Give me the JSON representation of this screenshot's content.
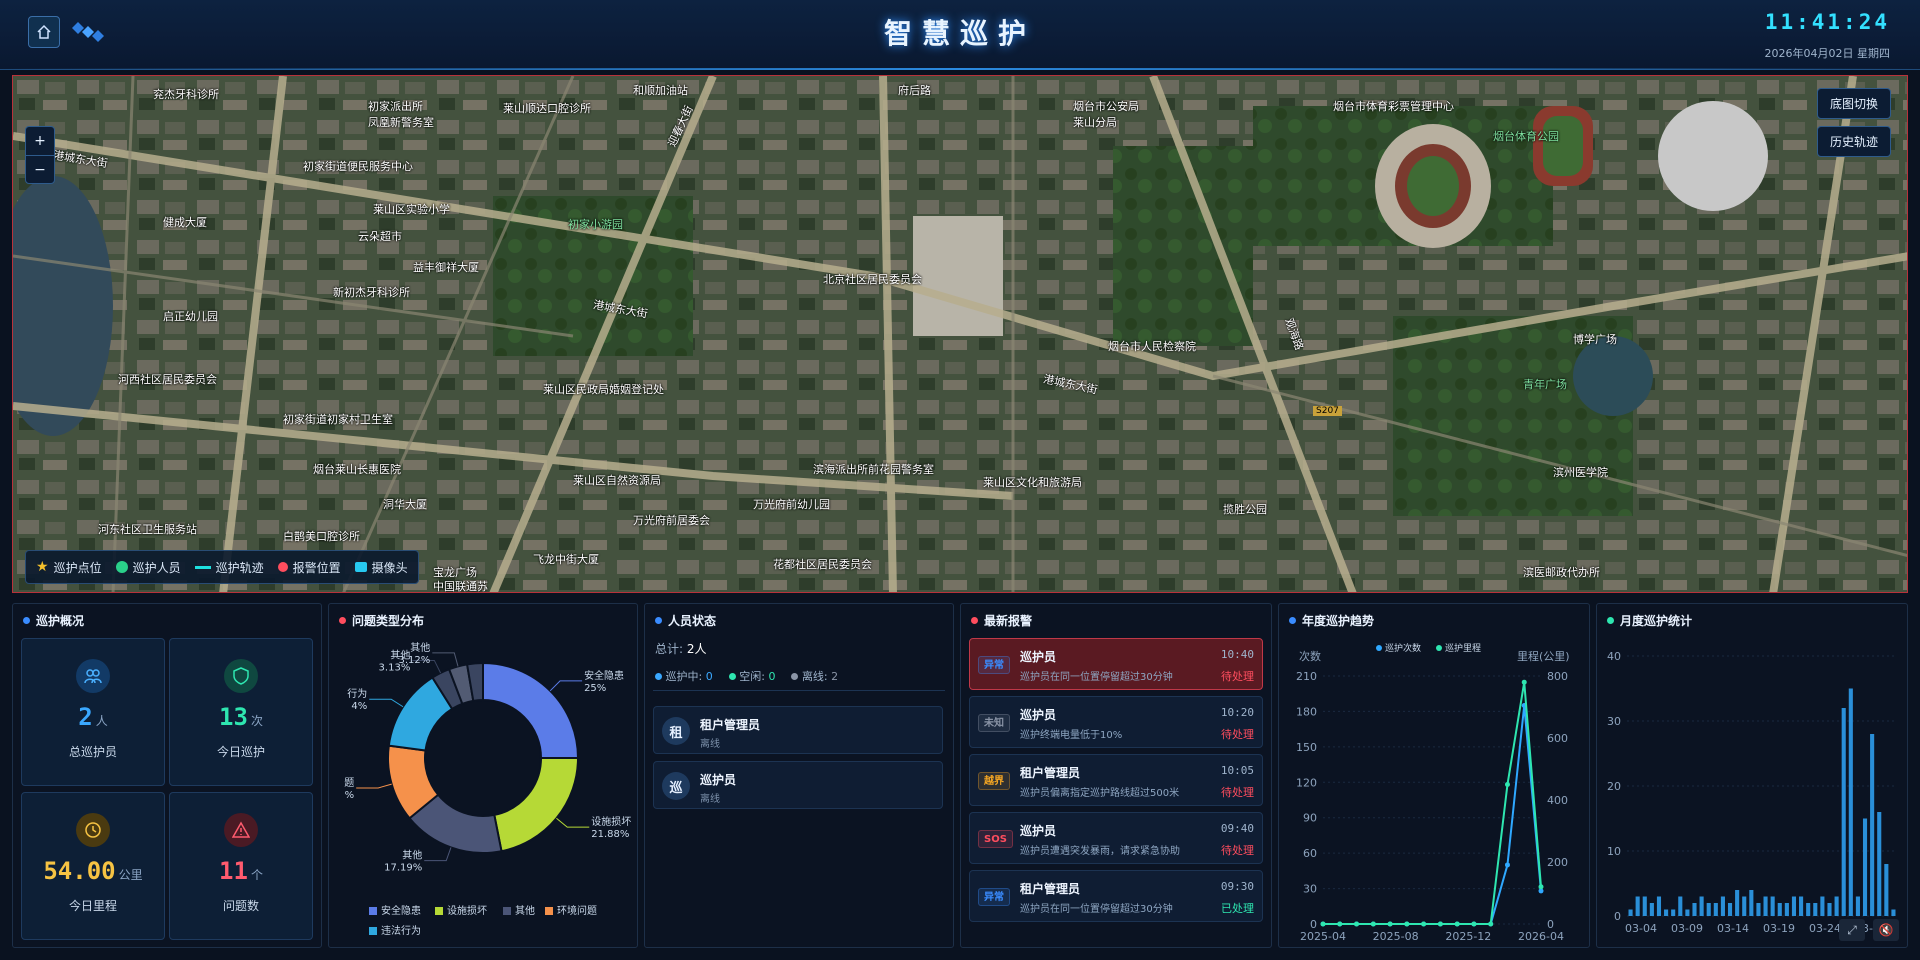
{
  "header": {
    "title": "智慧巡护",
    "time": "11:41:24",
    "date": "2026年04月02日 星期四"
  },
  "map": {
    "buttons": {
      "basemap": "底图切换",
      "history": "历史轨迹"
    },
    "zoom_in": "+",
    "zoom_out": "−",
    "legend": [
      {
        "label": "巡护点位",
        "color": "#f5c02c"
      },
      {
        "label": "巡护人员",
        "color": "#2ad08a"
      },
      {
        "label": "巡护轨迹",
        "color": "#1ee0e0"
      },
      {
        "label": "报警位置",
        "color": "#ff4d5e"
      },
      {
        "label": "摄像头",
        "color": "#27c9f0"
      }
    ],
    "labels": [
      "兖杰牙科诊所",
      "初家派出所",
      "凤凰新警务室",
      "莱山顺达口腔诊所",
      "和顺加油站",
      "府后路",
      "烟台市公安局",
      "莱山分局",
      "烟台市体育彩票管理中心",
      "烟台体育公园",
      "初家街道便民服务中心",
      "莱山区实验小学",
      "健成大厦",
      "云朵超市",
      "初家小游园",
      "益丰御祥大厦",
      "新初杰牙科诊所",
      "启正幼儿园",
      "北京社区居民委员会",
      "烟台市人民检察院",
      "河西社区居民委员会",
      "莱山区民政局婚姻登记处",
      "初家街道初家村卫生室",
      "烟台莱山长惠医院",
      "莱山区自然资源局",
      "滨海派出所前花园警务室",
      "万光府前幼儿园",
      "莱山区文化和旅游局",
      "洞华大厦",
      "万光府前居委会",
      "揽胜公园",
      "河东社区卫生服务站",
      "白鹊美口腔诊所",
      "飞龙中街大厦",
      "花都社区居民委员会",
      "宝龙广场",
      "中国联通苏",
      "滨医邮政代办所",
      "青年广场",
      "博学广场",
      "滨州医学院",
      "港城东大街",
      "港城东大街",
      "港城东大街",
      "观海路",
      "迎春大街",
      "S207"
    ]
  },
  "overview": {
    "title": "巡护概况",
    "cards": [
      {
        "value": "2",
        "unit": "人",
        "label": "总巡护员",
        "color": "#3aa8ff"
      },
      {
        "value": "13",
        "unit": "次",
        "label": "今日巡护",
        "color": "#2ee6b0"
      },
      {
        "value": "54.00",
        "unit": "公里",
        "label": "今日里程",
        "color": "#f6c343"
      },
      {
        "value": "11",
        "unit": "个",
        "label": "问题数",
        "color": "#ff5b6e"
      }
    ]
  },
  "issues": {
    "title": "问题类型分布",
    "chart_data": {
      "type": "pie",
      "slices": [
        {
          "name": "安全隐患",
          "value": 25,
          "color": "#5b7ce8",
          "label": "安全隐患",
          "pct": "25%"
        },
        {
          "name": "设施损坏",
          "value": 21.88,
          "color": "#b6d936",
          "label": "设施损坏",
          "pct": "21.88%"
        },
        {
          "name": "其他",
          "value": 17.19,
          "color": "#4b5577",
          "label": "其他",
          "pct": "17.19%"
        },
        {
          "name": "环境问题",
          "value": 13,
          "color": "#f5914b",
          "label": "题",
          "pct": "%"
        },
        {
          "name": "违法行为",
          "value": 14,
          "color": "#2fa8e0",
          "label": "行为",
          "pct": "4%"
        },
        {
          "name": "其他",
          "value": 3.13,
          "color": "#3a4560",
          "label": "其他",
          "pct": "3.13%"
        },
        {
          "name": "其他",
          "value": 3.12,
          "color": "#525b73",
          "label": "其他",
          "pct": "3.12%"
        },
        {
          "name": "其他",
          "value": 2.68,
          "color": "#3a4560",
          "label": "",
          "pct": ""
        }
      ],
      "legend": [
        "安全隐患",
        "设施损坏",
        "其他",
        "环境问题",
        "违法行为"
      ]
    }
  },
  "people": {
    "title": "人员状态",
    "total_label": "总计:",
    "total_value": "2人",
    "statuses": [
      {
        "label": "巡护中:",
        "value": "0",
        "color": "#3aa8ff"
      },
      {
        "label": "空闲:",
        "value": "0",
        "color": "#2ee6b0"
      },
      {
        "label": "离线:",
        "value": "2",
        "color": "#8a94a6"
      }
    ],
    "list": [
      {
        "avatar": "租",
        "name": "租户管理员",
        "status": "离线"
      },
      {
        "avatar": "巡",
        "name": "巡护员",
        "status": "离线"
      }
    ]
  },
  "alerts": {
    "title": "最新报警",
    "items": [
      {
        "tag": "异常",
        "tag_color": "#3a8cff",
        "name": "巡护员",
        "desc": "巡护员在同一位置停留超过30分钟",
        "time": "10:40",
        "status": "待处理",
        "status_color": "#ff4d5e",
        "hot": true
      },
      {
        "tag": "未知",
        "tag_color": "#8a94a6",
        "name": "巡护员",
        "desc": "巡护终端电量低于10%",
        "time": "10:20",
        "status": "待处理",
        "status_color": "#ff4d5e",
        "hot": false
      },
      {
        "tag": "越界",
        "tag_color": "#f5a623",
        "name": "租户管理员",
        "desc": "巡护员偏离指定巡护路线超过500米",
        "time": "10:05",
        "status": "待处理",
        "status_color": "#ff4d5e",
        "hot": false
      },
      {
        "tag": "SOS",
        "tag_color": "#ff4d5e",
        "name": "巡护员",
        "desc": "巡护员遭遇突发暴雨，请求紧急协助",
        "time": "09:40",
        "status": "待处理",
        "status_color": "#ff4d5e",
        "hot": false
      },
      {
        "tag": "异常",
        "tag_color": "#3a8cff",
        "name": "租户管理员",
        "desc": "巡护员在同一位置停留超过30分钟",
        "time": "09:30",
        "status": "已处理",
        "status_color": "#2ee6b0",
        "hot": false
      }
    ]
  },
  "trend": {
    "title": "年度巡护趋势",
    "chart_data": {
      "type": "line",
      "left_axis_label": "次数",
      "right_axis_label": "里程(公里)",
      "legend": [
        "巡护次数",
        "巡护里程"
      ],
      "x_ticks": [
        "2025-04",
        "2025-08",
        "2025-12",
        "2026-04"
      ],
      "y_left_ticks": [
        0,
        30,
        60,
        90,
        120,
        150,
        180,
        210
      ],
      "y_right_ticks": [
        0,
        200,
        400,
        600,
        800
      ],
      "ylim_left": [
        0,
        210
      ],
      "ylim_right": [
        0,
        800
      ],
      "x": [
        0,
        1,
        2,
        3,
        4,
        5,
        6,
        7,
        8,
        9,
        10,
        11,
        12
      ],
      "series": [
        {
          "name": "巡护次数",
          "color": "#2fa8ff",
          "axis": "left",
          "values": [
            0,
            0,
            0,
            0,
            0,
            0,
            0,
            0,
            0,
            0,
            0,
            50,
            185,
            28
          ]
        },
        {
          "name": "巡护里程",
          "color": "#2ee6b0",
          "axis": "right",
          "values": [
            0,
            0,
            0,
            0,
            0,
            0,
            0,
            0,
            0,
            0,
            0,
            450,
            780,
            120
          ]
        }
      ]
    }
  },
  "monthly": {
    "title": "月度巡护统计",
    "chart_data": {
      "type": "bar",
      "x_ticks": [
        "03-04",
        "03-09",
        "03-14",
        "03-19",
        "03-24",
        "03-29"
      ],
      "y_ticks": [
        0,
        10,
        20,
        30,
        40
      ],
      "ylim": [
        0,
        40
      ],
      "values": [
        1,
        3,
        3,
        2,
        3,
        1,
        1,
        3,
        1,
        2,
        3,
        2,
        2,
        3,
        2,
        4,
        3,
        4,
        2,
        3,
        3,
        2,
        2,
        3,
        3,
        2,
        2,
        3,
        2,
        3,
        32,
        35,
        3,
        15,
        28,
        16,
        8,
        1
      ]
    },
    "expand": "expand-icon",
    "mute": "mute-icon"
  }
}
